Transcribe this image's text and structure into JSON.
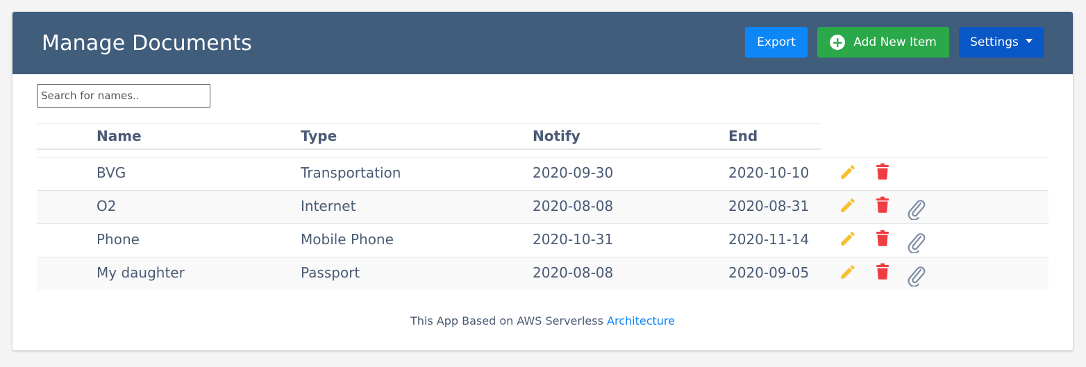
{
  "header": {
    "title": "Manage Documents",
    "export_label": "Export",
    "add_label": "Add New Item",
    "settings_label": "Settings"
  },
  "search": {
    "placeholder": "Search for names.."
  },
  "table": {
    "columns": [
      "Name",
      "Type",
      "Notify",
      "End"
    ],
    "rows": [
      {
        "name": "BVG",
        "type": "Transportation",
        "notify": "2020-09-30",
        "end": "2020-10-10",
        "attachment": false
      },
      {
        "name": "O2",
        "type": "Internet",
        "notify": "2020-08-08",
        "end": "2020-08-31",
        "attachment": true
      },
      {
        "name": "Phone",
        "type": "Mobile Phone",
        "notify": "2020-10-31",
        "end": "2020-11-14",
        "attachment": true
      },
      {
        "name": "My daughter",
        "type": "Passport",
        "notify": "2020-08-08",
        "end": "2020-09-05",
        "attachment": true
      }
    ]
  },
  "footer": {
    "text": "This App Based on AWS Serverless",
    "link_text": "Architecture"
  },
  "colors": {
    "header_bg": "#415d7c",
    "export_bg": "#0d86f7",
    "add_bg": "#2aa84a",
    "settings_bg": "#0a58c7",
    "edit_icon": "#f6c02e",
    "delete_icon": "#ee3d43",
    "attach_icon": "#7c8ba3",
    "link": "#0d86f7"
  },
  "icons": {
    "edit": "pencil-icon",
    "delete": "trash-icon",
    "attach": "paperclip-icon",
    "add": "plus-circle-icon",
    "settings": "caret-down-icon"
  }
}
